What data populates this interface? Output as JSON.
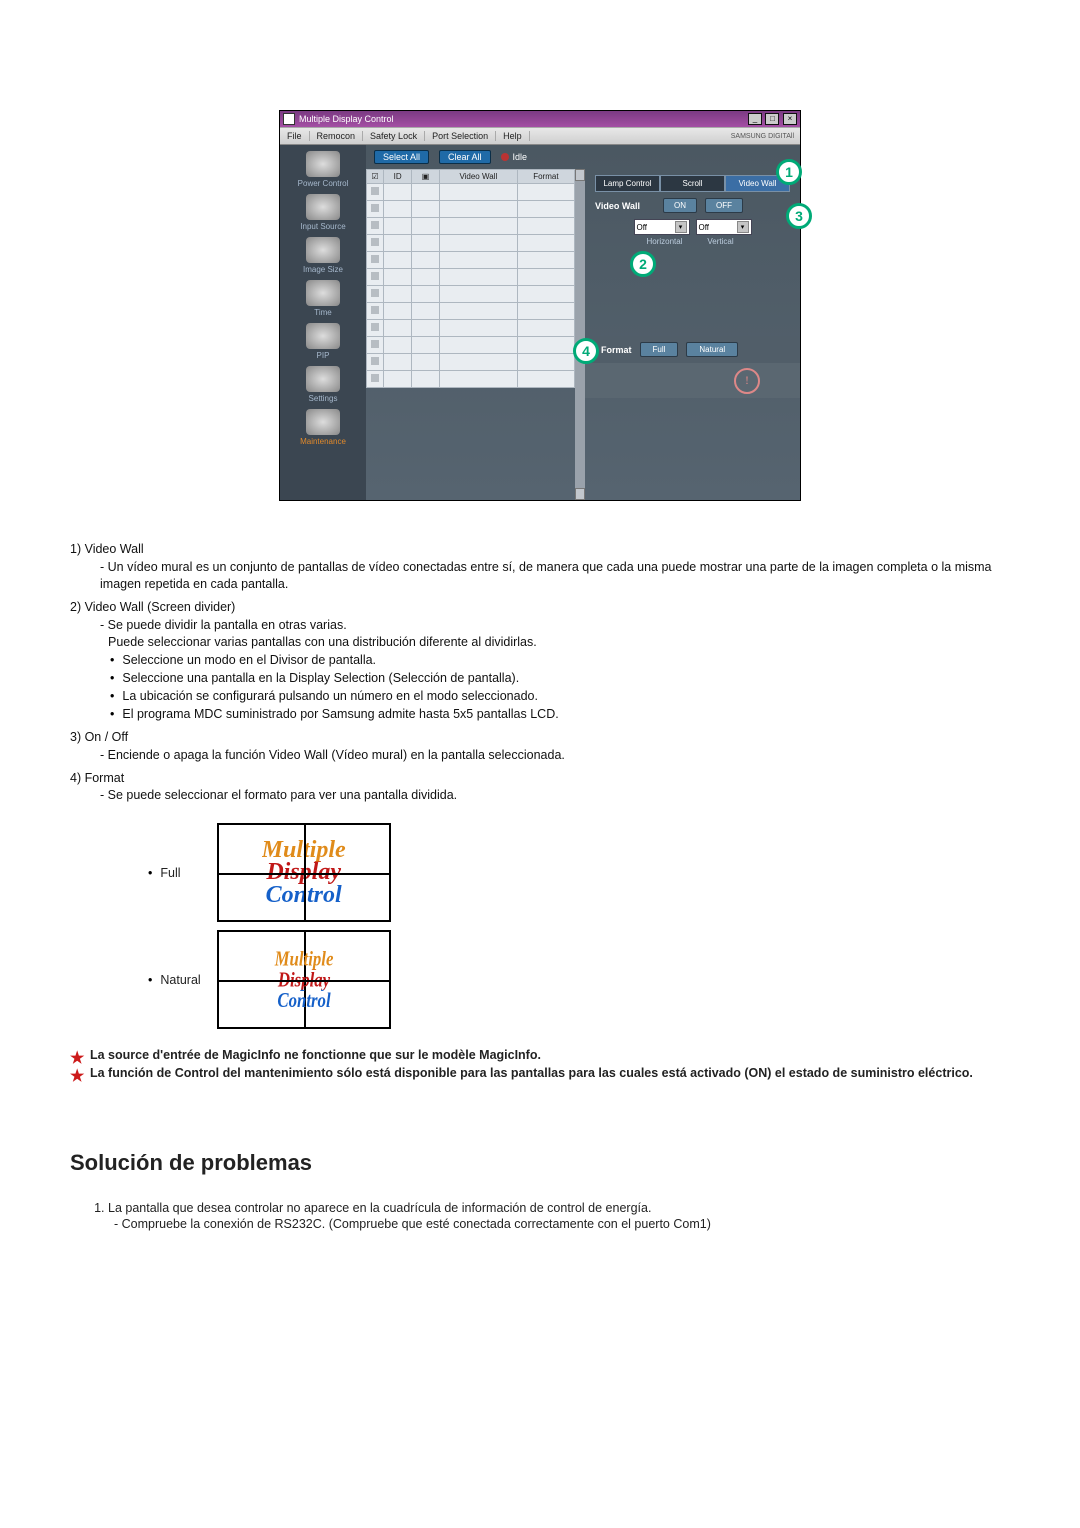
{
  "window": {
    "title": "Multiple Display Control",
    "menubar": [
      "File",
      "Remocon",
      "Safety Lock",
      "Port Selection",
      "Help"
    ],
    "brand": "SAMSUNG DIGITAll"
  },
  "sidebar": {
    "items": [
      {
        "label": "Power Control"
      },
      {
        "label": "Input Source"
      },
      {
        "label": "Image Size"
      },
      {
        "label": "Time"
      },
      {
        "label": "PIP"
      },
      {
        "label": "Settings"
      },
      {
        "label": "Maintenance"
      }
    ]
  },
  "toolbar": {
    "select_all": "Select All",
    "clear_all": "Clear All",
    "idle": "Idle"
  },
  "grid": {
    "headers": {
      "check": "☑",
      "id": "ID",
      "state": "▣",
      "vw": "Video Wall",
      "format": "Format"
    }
  },
  "panel": {
    "tabs": {
      "lamp": "Lamp Control",
      "scroll": "Scroll",
      "videowall": "Video Wall"
    },
    "vw_label": "Video Wall",
    "on": "ON",
    "off": "OFF",
    "drop1": "Off",
    "drop2": "Off",
    "horizontal": "Horizontal",
    "vertical": "Vertical"
  },
  "footer": {
    "format_label": "Format",
    "full": "Full",
    "natural": "Natural"
  },
  "badges": {
    "b1": "1",
    "b2": "2",
    "b3": "3",
    "b4": "4"
  },
  "doc": {
    "n1_title": "1)  Video Wall",
    "n1_line": "- Un vídeo mural es un conjunto de pantallas de vídeo conectadas entre sí, de manera que cada una puede mostrar una parte de la imagen completa o la misma imagen repetida en cada pantalla.",
    "n2_title": "2)  Video Wall (Screen divider)",
    "n2_a": "- Se puede dividir la pantalla en otras varias.",
    "n2_b": "Puede seleccionar varias pantallas con una distribución diferente al dividirlas.",
    "n2_b1": "Seleccione un modo en el Divisor de pantalla.",
    "n2_b2": "Seleccione una pantalla en la Display Selection (Selección de pantalla).",
    "n2_b3": "La ubicación se configurará pulsando un número en el modo seleccionado.",
    "n2_b4": "El programa MDC suministrado por Samsung admite hasta 5x5 pantallas LCD.",
    "n3_title": "3)  On / Off",
    "n3_line": "- Enciende o apaga la función Video Wall (Vídeo mural) en la pantalla seleccionada.",
    "n4_title": "4)  Format",
    "n4_line": "- Se puede seleccionar el formato para ver una pantalla dividida.",
    "format_full": "Full",
    "format_natural": "Natural",
    "vw_text": "Multiple Display Control",
    "star1": "La source d'entrée de MagicInfo ne fonctionne que sur le modèle MagicInfo.",
    "star2": "La función de Control del mantenimiento sólo está disponible para las pantallas para las cuales está activado (ON) el estado de suministro eléctrico.",
    "section_title": "Solución de problemas",
    "t1": "La pantalla que desea controlar no aparece en la cuadrícula de información de control de energía.",
    "t1a": "- Compruebe la conexión de RS232C. (Compruebe que esté conectada correctamente con el puerto Com1)"
  }
}
